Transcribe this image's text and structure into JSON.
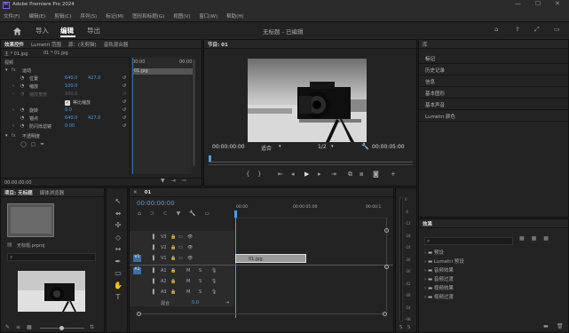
{
  "app": {
    "logo": "Pr",
    "title": "Adobe Premiere Pro 2024"
  },
  "window_controls": {
    "min": "—",
    "max": "☐",
    "close": "✕"
  },
  "menu": [
    "文件(F)",
    "编辑(E)",
    "剪辑(C)",
    "序列(S)",
    "标记(M)",
    "图形和标题(G)",
    "视图(V)",
    "窗口(W)",
    "帮助(H)"
  ],
  "header": {
    "tabs": [
      "导入",
      "编辑",
      "导出"
    ],
    "active": "编辑",
    "project_title": "无标题 - 已编辑"
  },
  "effect_controls": {
    "tabs": [
      "效果控件",
      "Lumetri 范围",
      "源：(无剪辑)",
      "音轨混合器"
    ],
    "source": "主 * 01.jpg",
    "seq": "01 * 01.jpg",
    "time_start": "00:00",
    "time_end": "00:00",
    "clip_name": "01.jpg",
    "video_label": "视频",
    "motion": "运动",
    "props": [
      {
        "name": "位置",
        "v1": "640.0",
        "v2": "427.0"
      },
      {
        "name": "缩放",
        "v1": "100.0",
        "v2": ""
      },
      {
        "name": "缩放宽度",
        "v1": "100.0",
        "v2": ""
      },
      {
        "name": "等比缩放",
        "v1": "",
        "v2": ""
      },
      {
        "name": "旋转",
        "v1": "0.0",
        "v2": ""
      },
      {
        "name": "锚点",
        "v1": "640.0",
        "v2": "427.0"
      },
      {
        "name": "防闪烁滤镜",
        "v1": "0.00",
        "v2": ""
      }
    ],
    "opacity": "不透明度",
    "footer_time": "00:00:00:00"
  },
  "program": {
    "tab": "节目: 01",
    "tc_left": "00:00:00:00",
    "fit": "适合",
    "ratio": "1/2",
    "tc_right": "00:00:05:00"
  },
  "right_panels": {
    "top_tab": "库",
    "items": [
      "标记",
      "历史记录",
      "信息",
      "基本图形",
      "基本声音",
      "Lumetri 颜色"
    ]
  },
  "project": {
    "tabs": [
      "项目: 无标题",
      "媒体浏览器"
    ],
    "file": "无标题.prproj"
  },
  "timeline": {
    "tab": "01",
    "timecode": "00:00:00:00",
    "ruler": [
      "00:00",
      "00:00:05:00",
      "00:00:1"
    ],
    "tracks": [
      "V3",
      "V2",
      "V1",
      "A1",
      "A2",
      "A3"
    ],
    "mix": "混合",
    "mix_val": "0.0",
    "clip": "01.jpg"
  },
  "meter": {
    "scale": [
      "0",
      "-6",
      "-12",
      "-18",
      "-24",
      "-30",
      "-36",
      "-42",
      "-48",
      "-54",
      "-dB"
    ]
  },
  "effects": {
    "tab": "效果",
    "items": [
      "预设",
      "Lumetri 预设",
      "音频效果",
      "音频过渡",
      "视频效果",
      "视频过渡"
    ]
  },
  "colors": {
    "accent": "#4b9fe8",
    "clip": "#9a9a9a",
    "bg": "#1d1d1d"
  }
}
